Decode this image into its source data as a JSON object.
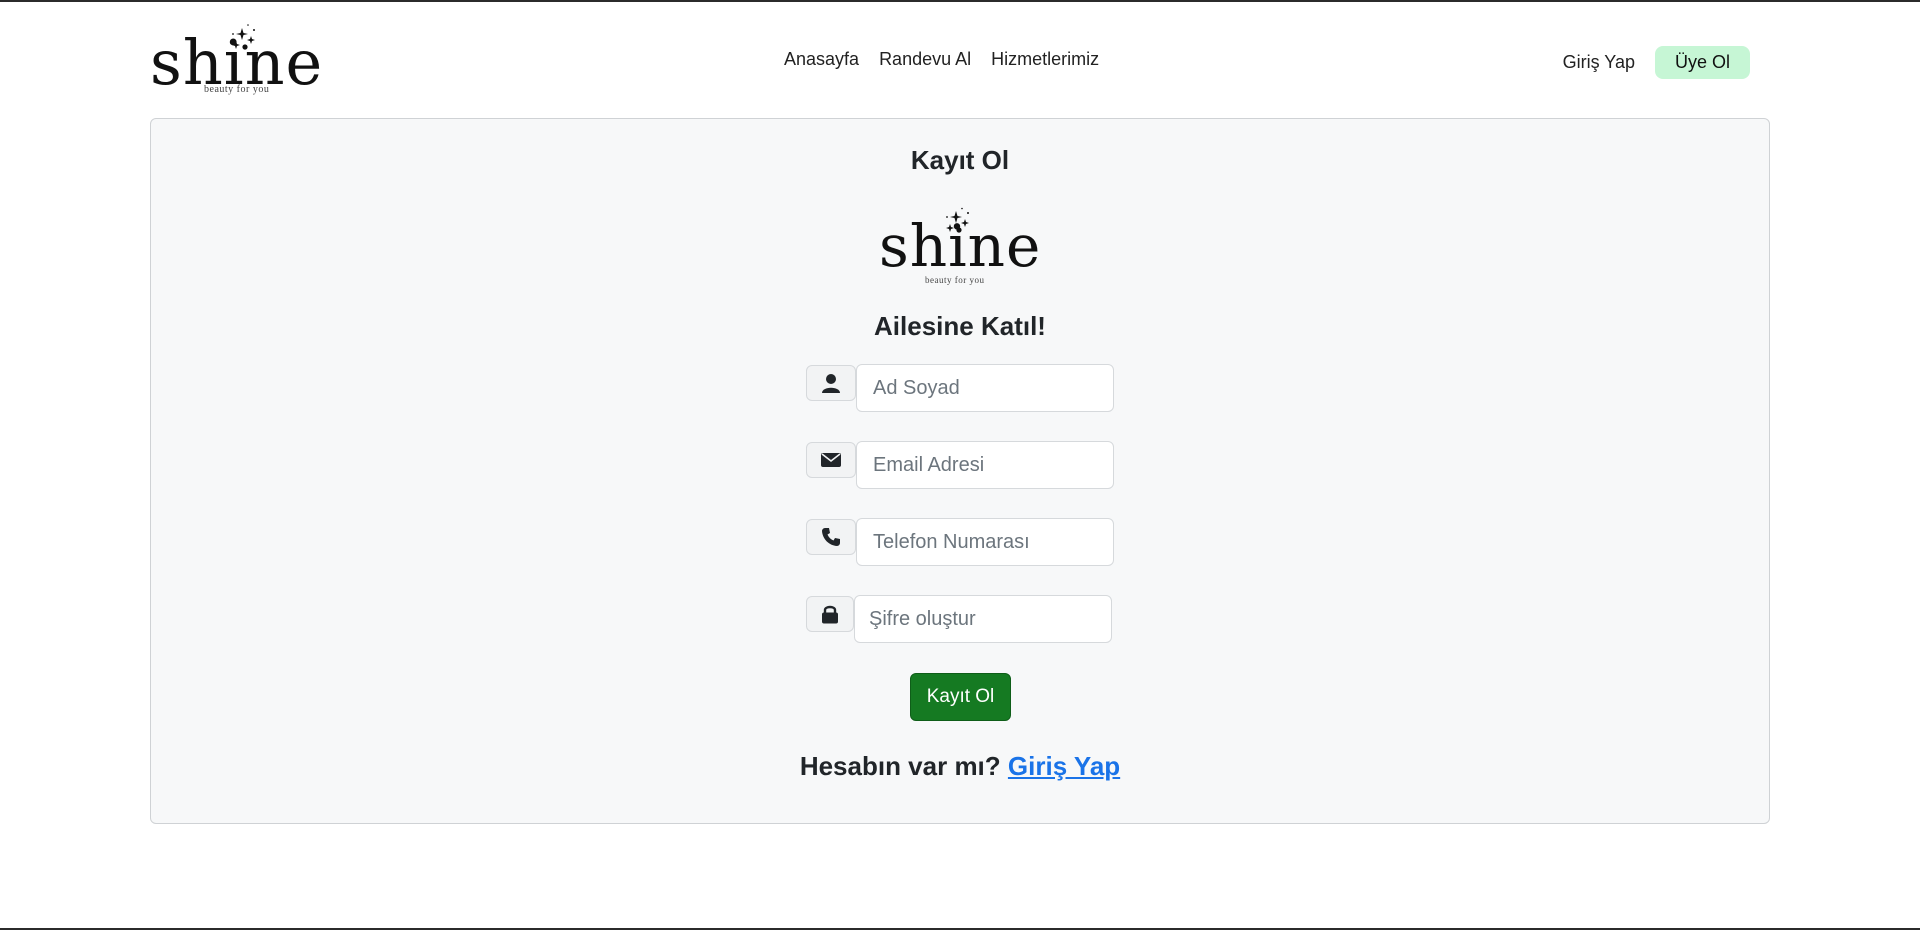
{
  "header": {
    "logo": {
      "word": "shine",
      "tagline": "beauty for you"
    },
    "nav": [
      {
        "label": "Anasayfa"
      },
      {
        "label": "Randevu Al"
      },
      {
        "label": "Hizmetlerimiz"
      }
    ],
    "login_label": "Giriş Yap",
    "signup_label": "Üye Ol"
  },
  "card": {
    "title": "Kayıt Ol",
    "logo": {
      "word": "shine",
      "tagline": "beauty for you"
    },
    "subtitle": "Ailesine Katıl!",
    "fields": {
      "name": {
        "placeholder": "Ad Soyad",
        "icon": "user-icon"
      },
      "email": {
        "placeholder": "Email Adresi",
        "icon": "envelope-icon"
      },
      "phone": {
        "placeholder": "Telefon Numarası",
        "icon": "phone-icon"
      },
      "password": {
        "placeholder": "Şifre oluştur",
        "icon": "lock-icon"
      }
    },
    "submit_label": "Kayıt Ol",
    "footer_prompt": "Hesabın var mı?",
    "footer_link": "Giriş Yap"
  },
  "colors": {
    "signup_bg": "#c6f6d5",
    "submit_bg": "#157a22",
    "link": "#1a73e8",
    "card_bg": "#f7f8f9"
  }
}
